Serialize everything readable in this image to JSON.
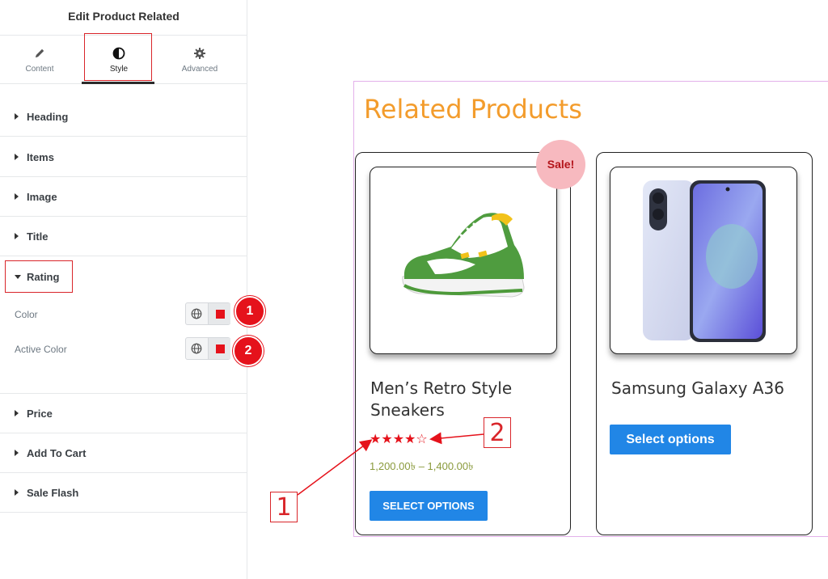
{
  "panel": {
    "title": "Edit Product Related",
    "tabs": [
      {
        "label": "Content",
        "icon": "pencil-icon"
      },
      {
        "label": "Style",
        "icon": "half-circle-icon"
      },
      {
        "label": "Advanced",
        "icon": "gear-icon"
      }
    ],
    "active_tab": "Style",
    "sections_before": [
      {
        "label": "Heading"
      },
      {
        "label": "Items"
      },
      {
        "label": "Image"
      },
      {
        "label": "Title"
      }
    ],
    "rating": {
      "label": "Rating",
      "expanded": true,
      "controls": [
        {
          "label": "Color",
          "badge": "1",
          "swatch": "#e5121b"
        },
        {
          "label": "Active Color",
          "badge": "2",
          "swatch": "#e5121b"
        }
      ]
    },
    "sections_after": [
      {
        "label": "Price"
      },
      {
        "label": "Add To Cart"
      },
      {
        "label": "Sale Flash"
      }
    ]
  },
  "preview": {
    "heading": "Related Products",
    "heading_color": "#f39c2c",
    "products": [
      {
        "title": "Men’s Retro Style Sneakers",
        "sale_badge": "Sale!",
        "rating_stars": 4,
        "rating_max": 5,
        "price": "1,200.00৳ – 1,400.00৳",
        "button": "SELECT OPTIONS"
      },
      {
        "title": "Samsung Galaxy A36",
        "button": "Select options"
      }
    ],
    "callouts": [
      "1",
      "2"
    ],
    "accent_red": "#e5121b",
    "button_blue": "#2186e6"
  }
}
